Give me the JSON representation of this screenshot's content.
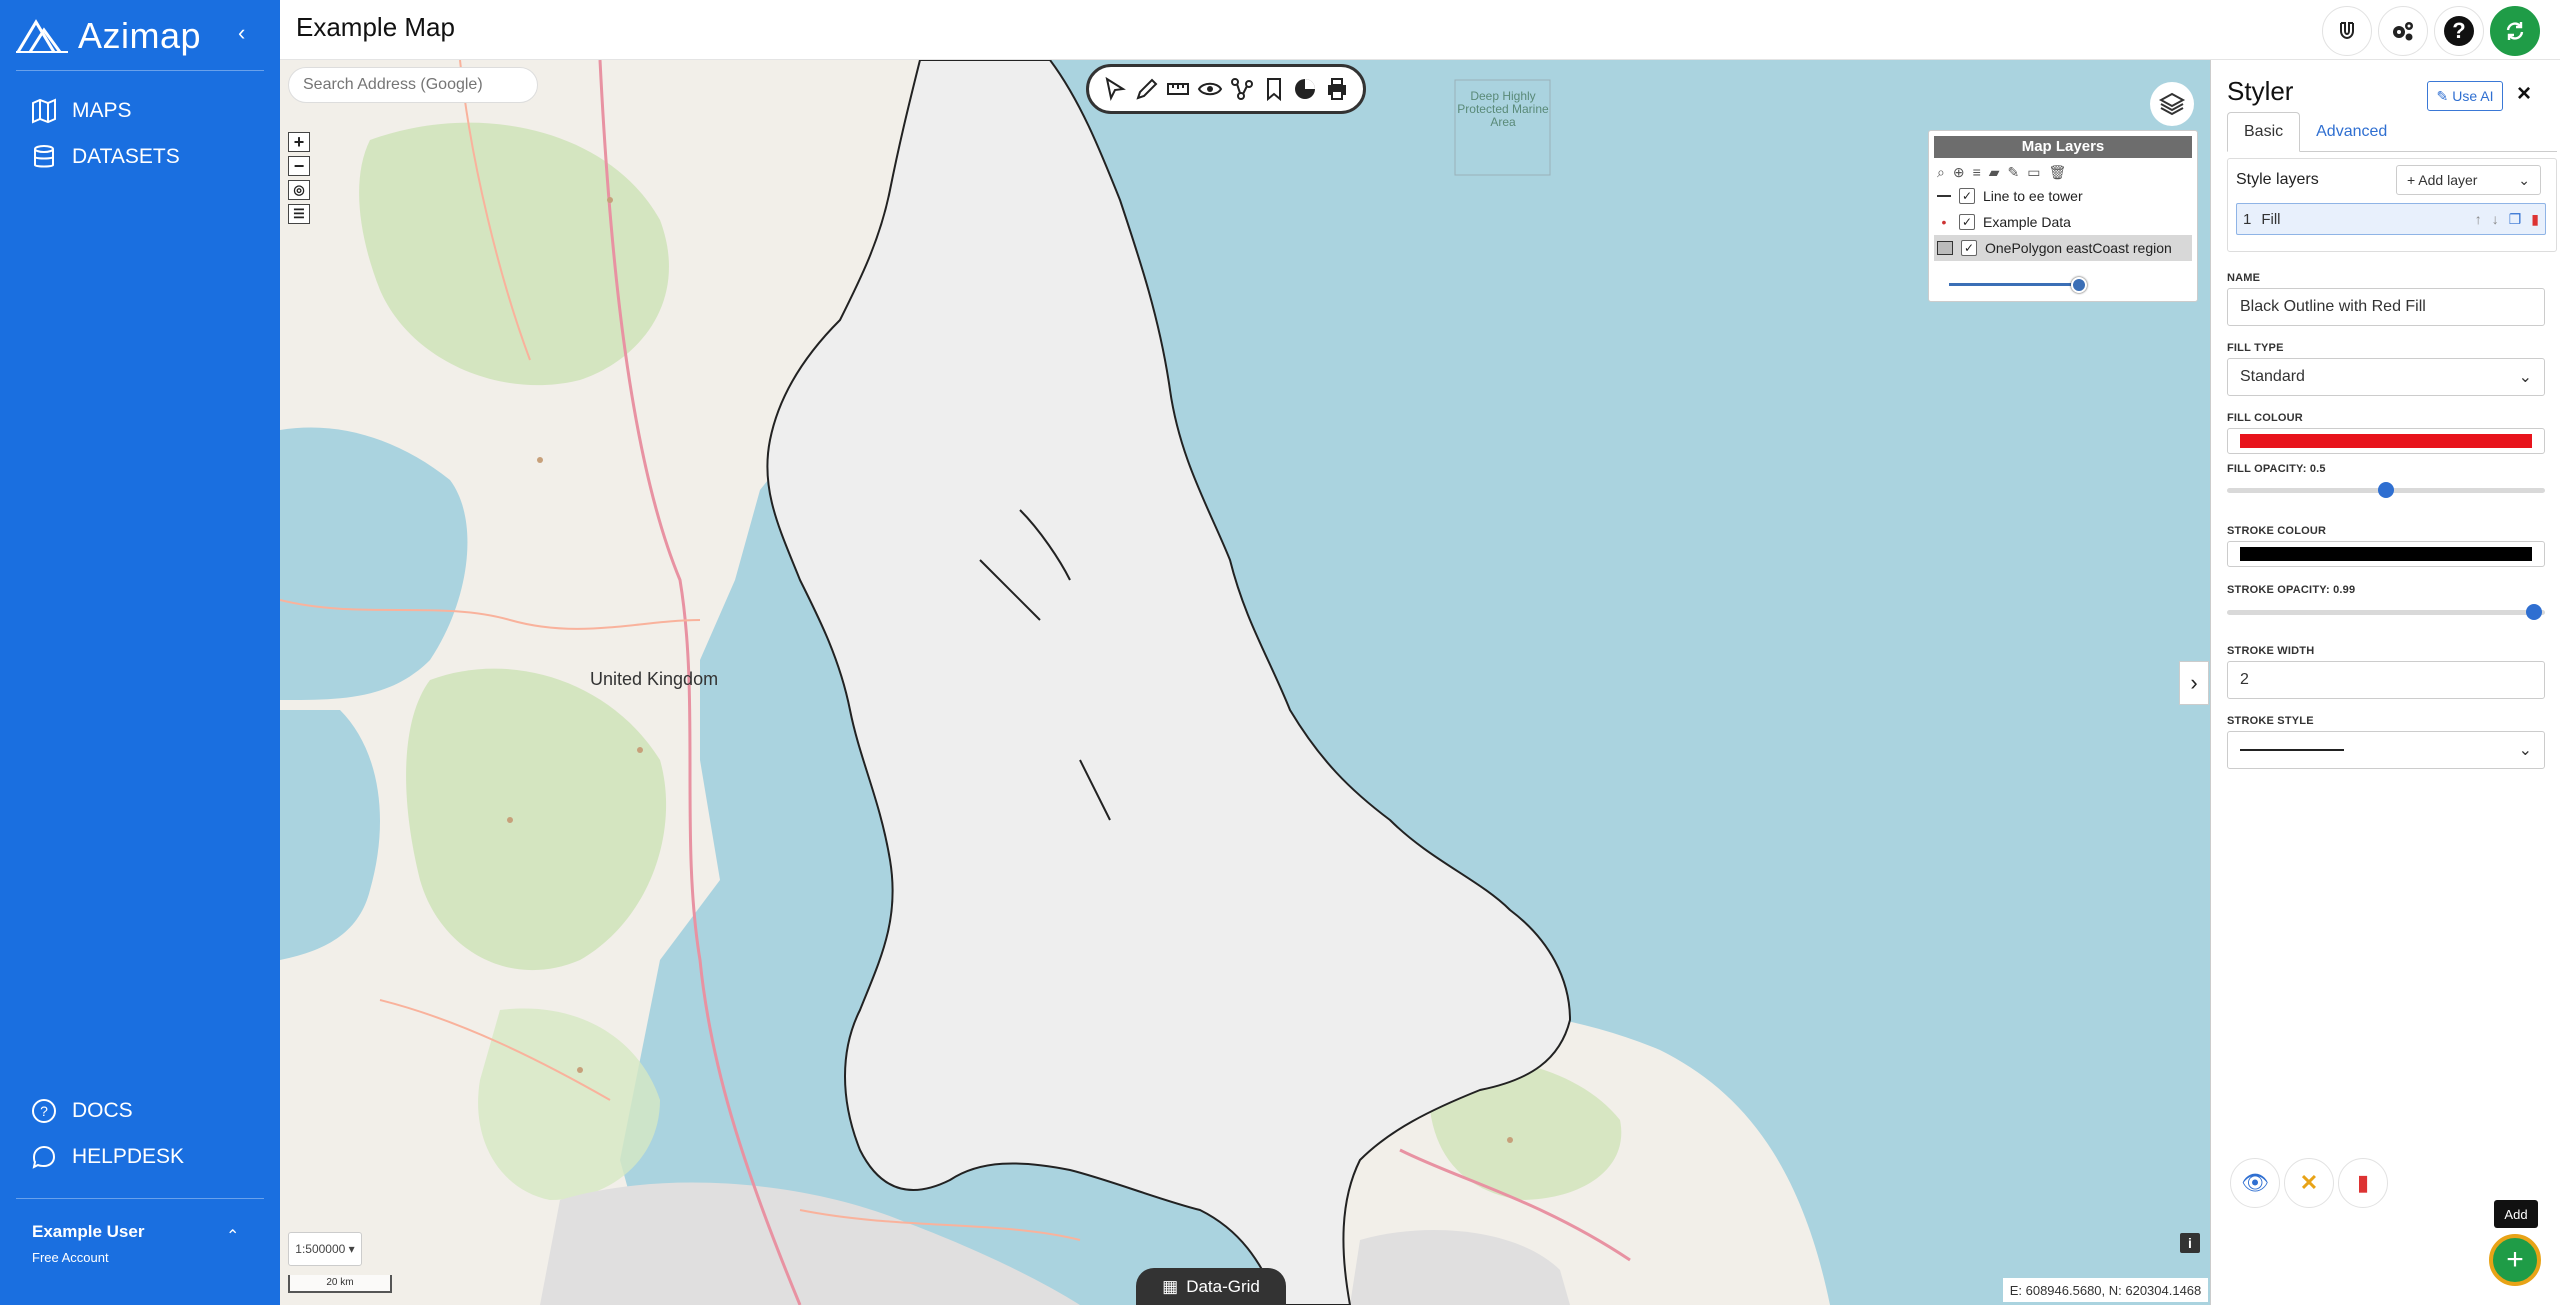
{
  "sidebar": {
    "brand": "Azimap",
    "nav": [
      {
        "label": "MAPS",
        "icon": "map-icon"
      },
      {
        "label": "DATASETS",
        "icon": "database-icon"
      }
    ],
    "bottom_nav": [
      {
        "label": "DOCS",
        "icon": "help-icon"
      },
      {
        "label": "HELPDESK",
        "icon": "chat-icon"
      }
    ],
    "user": {
      "name": "Example User",
      "plan": "Free Account"
    }
  },
  "header": {
    "title": "Example Map"
  },
  "map": {
    "search": {
      "placeholder": "Search Address (Google)"
    },
    "layers_panel": {
      "title": "Map Layers",
      "layers": [
        {
          "name": "Line to ee tower",
          "checked": true
        },
        {
          "name": "Example Data",
          "checked": true
        },
        {
          "name": "OnePolygon eastCoast region",
          "checked": true
        }
      ],
      "opacity": 0.95
    },
    "scale": "1:500000",
    "scale_bar": "20 km",
    "data_grid": "Data-Grid",
    "coordinates": "E: 608946.5680, N: 620304.1468",
    "labels": {
      "country": "United Kingdom",
      "deep_area": "Deep Highly Protected Marine Area"
    }
  },
  "styler": {
    "title": "Styler",
    "use_ai": "Use AI",
    "tabs": [
      "Basic",
      "Advanced"
    ],
    "style_layers_label": "Style layers",
    "add_layer": "+ Add layer",
    "layer_row": {
      "index": "1",
      "name": "Fill"
    },
    "fields": {
      "name_label": "NAME",
      "name_value": "Black Outline with Red Fill",
      "fill_type_label": "FILL TYPE",
      "fill_type_value": "Standard",
      "fill_colour_label": "FILL COLOUR",
      "fill_colour": "#e8141c",
      "fill_opacity_label": "FILL OPACITY: 0.5",
      "fill_opacity": 0.5,
      "stroke_colour_label": "STROKE COLOUR",
      "stroke_colour": "#000000",
      "stroke_opacity_label": "STROKE OPACITY: 0.99",
      "stroke_opacity": 0.99,
      "stroke_width_label": "STROKE WIDTH",
      "stroke_width_value": "2",
      "stroke_style_label": "STROKE STYLE"
    },
    "add_tooltip": "Add"
  },
  "colors": {
    "brand_blue": "#1a6fe0",
    "green": "#1f9c47",
    "accent_orange": "#e8a317"
  }
}
